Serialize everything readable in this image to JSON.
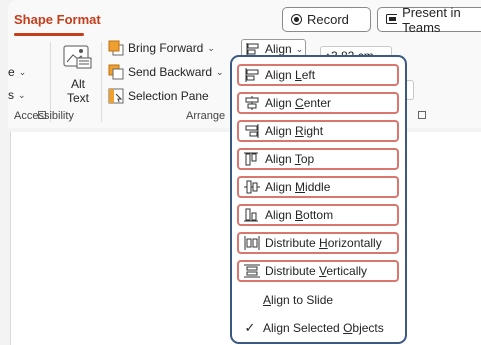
{
  "ribbon": {
    "active_tab": "Shape Format",
    "record_label": "Record",
    "present_label": "Present in Teams",
    "left_frag_1": "e",
    "left_frag_2": "s",
    "alt_text_label_1": "Alt",
    "alt_text_label_2": "Text",
    "bring_forward": "Bring Forward",
    "send_backward": "Send Backward",
    "selection_pane": "Selection Pane",
    "accessibility_group": "Accessibility",
    "arrange_group": "Arrange",
    "align_label": "Align",
    "height_value": "3.82 cm"
  },
  "align_menu": {
    "items": [
      {
        "pre": "Align ",
        "key": "L",
        "post": "eft",
        "highlighted": true
      },
      {
        "pre": "Align ",
        "key": "C",
        "post": "enter",
        "highlighted": true
      },
      {
        "pre": "Align ",
        "key": "R",
        "post": "ight",
        "highlighted": true
      },
      {
        "pre": "Align ",
        "key": "T",
        "post": "op",
        "highlighted": true
      },
      {
        "pre": "Align ",
        "key": "M",
        "post": "iddle",
        "highlighted": true
      },
      {
        "pre": "Align ",
        "key": "B",
        "post": "ottom",
        "highlighted": true
      },
      {
        "pre": "Distribute ",
        "key": "H",
        "post": "orizontally",
        "highlighted": true
      },
      {
        "pre": "Distribute ",
        "key": "V",
        "post": "ertically",
        "highlighted": true
      }
    ],
    "align_to_slide": {
      "pre": "",
      "key": "A",
      "post": "lign to Slide"
    },
    "align_selected": {
      "pre": "Align Selected ",
      "key": "O",
      "post": "bjects",
      "checked": true
    }
  }
}
